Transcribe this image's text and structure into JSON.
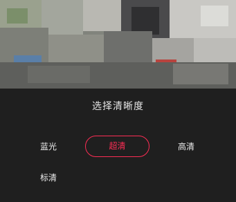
{
  "sheet": {
    "title": "选择清晰度",
    "options": [
      {
        "label": "蓝光",
        "selected": false
      },
      {
        "label": "超清",
        "selected": true
      },
      {
        "label": "高清",
        "selected": false
      },
      {
        "label": "标清",
        "selected": false
      }
    ]
  },
  "colors": {
    "accent": "#ff2d55",
    "sheet_background": "#1f1f1f",
    "text": "#ededed"
  }
}
